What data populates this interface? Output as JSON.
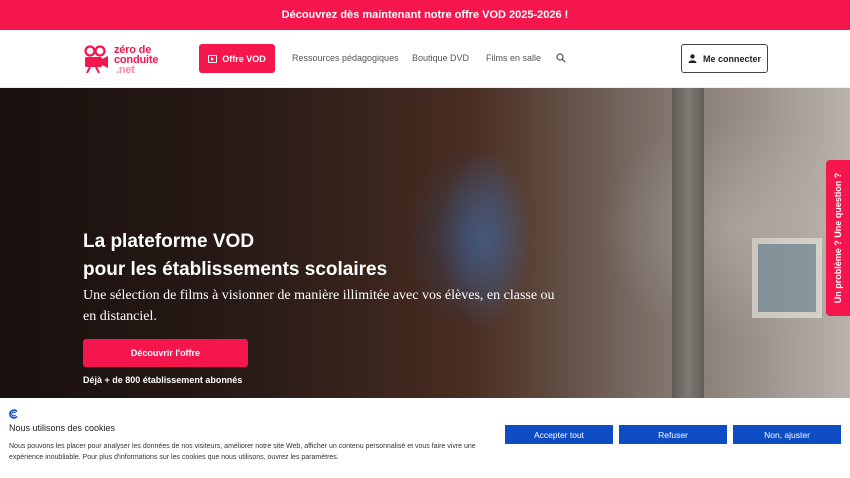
{
  "promo": {
    "text": "Découvrez dès maintenant notre offre VOD 2025-2026 !"
  },
  "logo": {
    "line1": "zéro de",
    "line2": "conduite",
    "line3": ".net"
  },
  "nav": {
    "vod_label": "Offre VOD",
    "links": [
      "Ressources pédagogiques",
      "Boutique DVD",
      "Films en salle"
    ],
    "login_label": "Me connecter"
  },
  "hero": {
    "title_line1": "La plateforme VOD",
    "title_line2": "pour les établissements scolaires",
    "subtitle": "Une sélection de films à visionner de manière illimitée avec vos élèves, en classe ou en distanciel.",
    "cta_label": "Découvrir l'offre",
    "subscribers": "Déjà + de 800 établissement abonnés"
  },
  "side_tab": {
    "label": "Un problème ? Une question ?"
  },
  "cookie": {
    "title": "Nous utilisons des cookies",
    "text": "Nous pouvons les placer pour analyser les données de nos visiteurs, améliorer notre site Web, afficher un contenu personnalisé et vous faire vivre une expérience inoubliable. Pour plus d'informations sur les cookies que nous utilisons, ouvrez les paramètres.",
    "accept_label": "Accepter tout",
    "refuse_label": "Refuser",
    "adjust_label": "Non, ajuster"
  },
  "colors": {
    "brand": "#f5164e",
    "cookie_button": "#0e4cc4"
  }
}
